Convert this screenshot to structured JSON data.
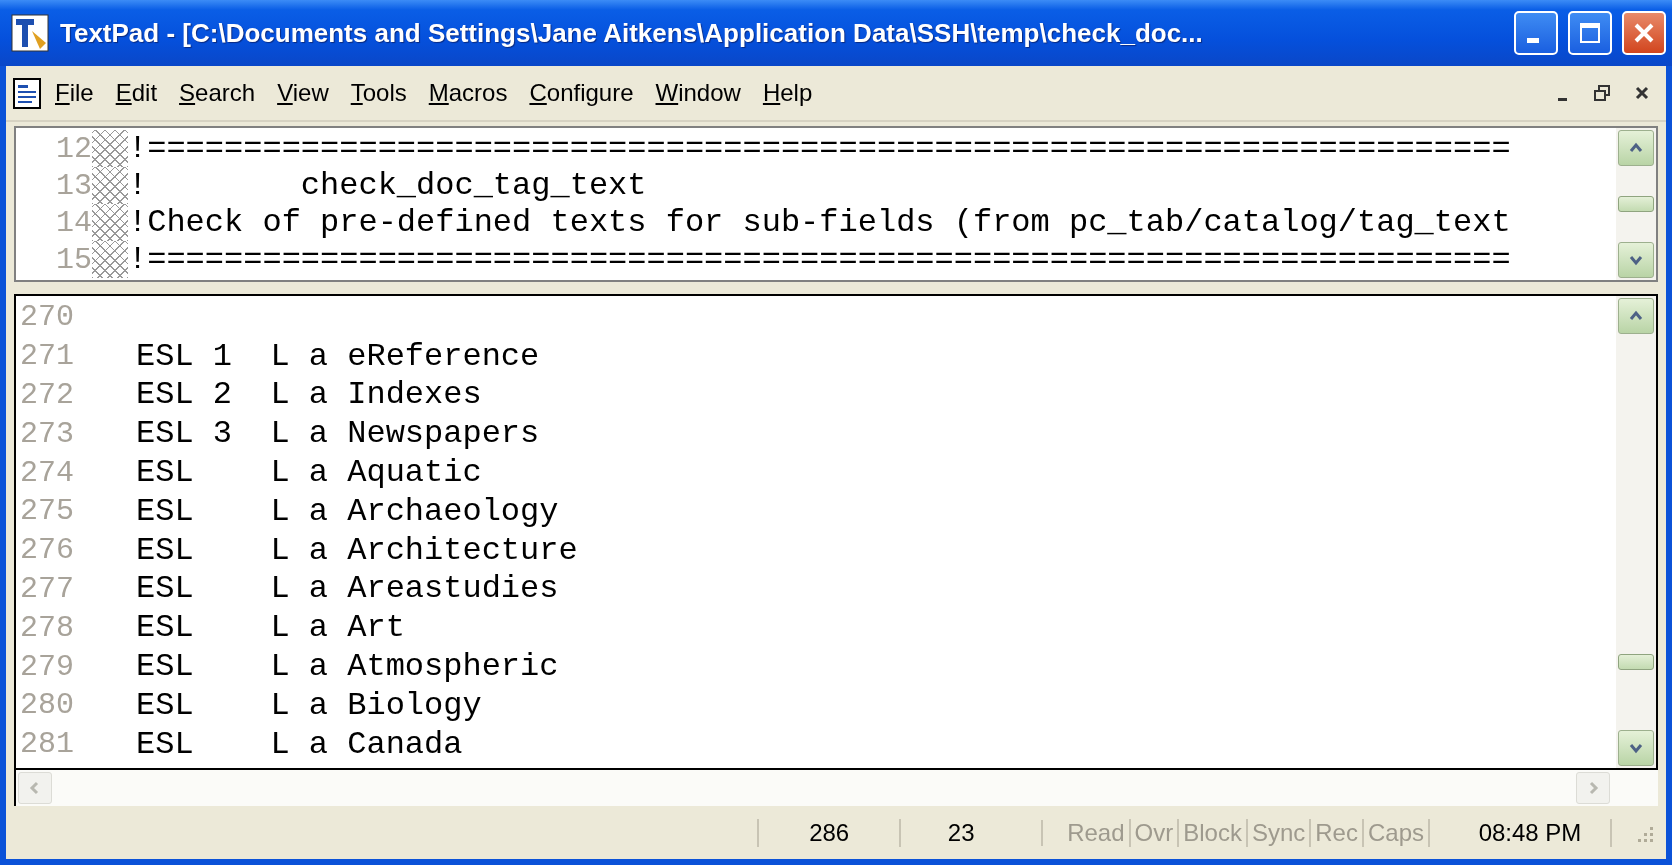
{
  "window": {
    "title": "TextPad - [C:\\Documents and Settings\\Jane Aitkens\\Application Data\\SSH\\temp\\check_doc..."
  },
  "menu": [
    "File",
    "Edit",
    "Search",
    "View",
    "Tools",
    "Macros",
    "Configure",
    "Window",
    "Help"
  ],
  "top_pane": {
    "lines": [
      {
        "number": "12",
        "text": "!======================================================================="
      },
      {
        "number": "13",
        "text": "!        check_doc_tag_text"
      },
      {
        "number": "14",
        "text": "!Check of pre-defined texts for sub-fields (from pc_tab/catalog/tag_text"
      },
      {
        "number": "15",
        "text": "!======================================================================="
      }
    ]
  },
  "bottom_pane": {
    "lines": [
      {
        "number": "270"
      },
      {
        "number": "271",
        "text": "ESL 1  L a eReference"
      },
      {
        "number": "272",
        "text": "ESL 2  L a Indexes"
      },
      {
        "number": "273",
        "text": "ESL 3  L a Newspapers"
      },
      {
        "number": "274",
        "text": "ESL    L a Aquatic"
      },
      {
        "number": "275",
        "text": "ESL    L a Archaeology"
      },
      {
        "number": "276",
        "text": "ESL    L a Architecture"
      },
      {
        "number": "277",
        "text": "ESL    L a Areastudies"
      },
      {
        "number": "278",
        "text": "ESL    L a Art"
      },
      {
        "number": "279",
        "text": "ESL    L a Atmospheric"
      },
      {
        "number": "280",
        "text": "ESL    L a Biology"
      },
      {
        "number": "281",
        "text": "ESL    L a Canada"
      }
    ]
  },
  "status_bar": {
    "line": "286",
    "column": "23",
    "indicators": [
      {
        "label": "Read",
        "on": false
      },
      {
        "label": "Ovr",
        "on": false
      },
      {
        "label": "Block",
        "on": false
      },
      {
        "label": "Sync",
        "on": false
      },
      {
        "label": "Rec",
        "on": false
      },
      {
        "label": "Caps",
        "on": false
      }
    ],
    "time": "08:48 PM"
  }
}
